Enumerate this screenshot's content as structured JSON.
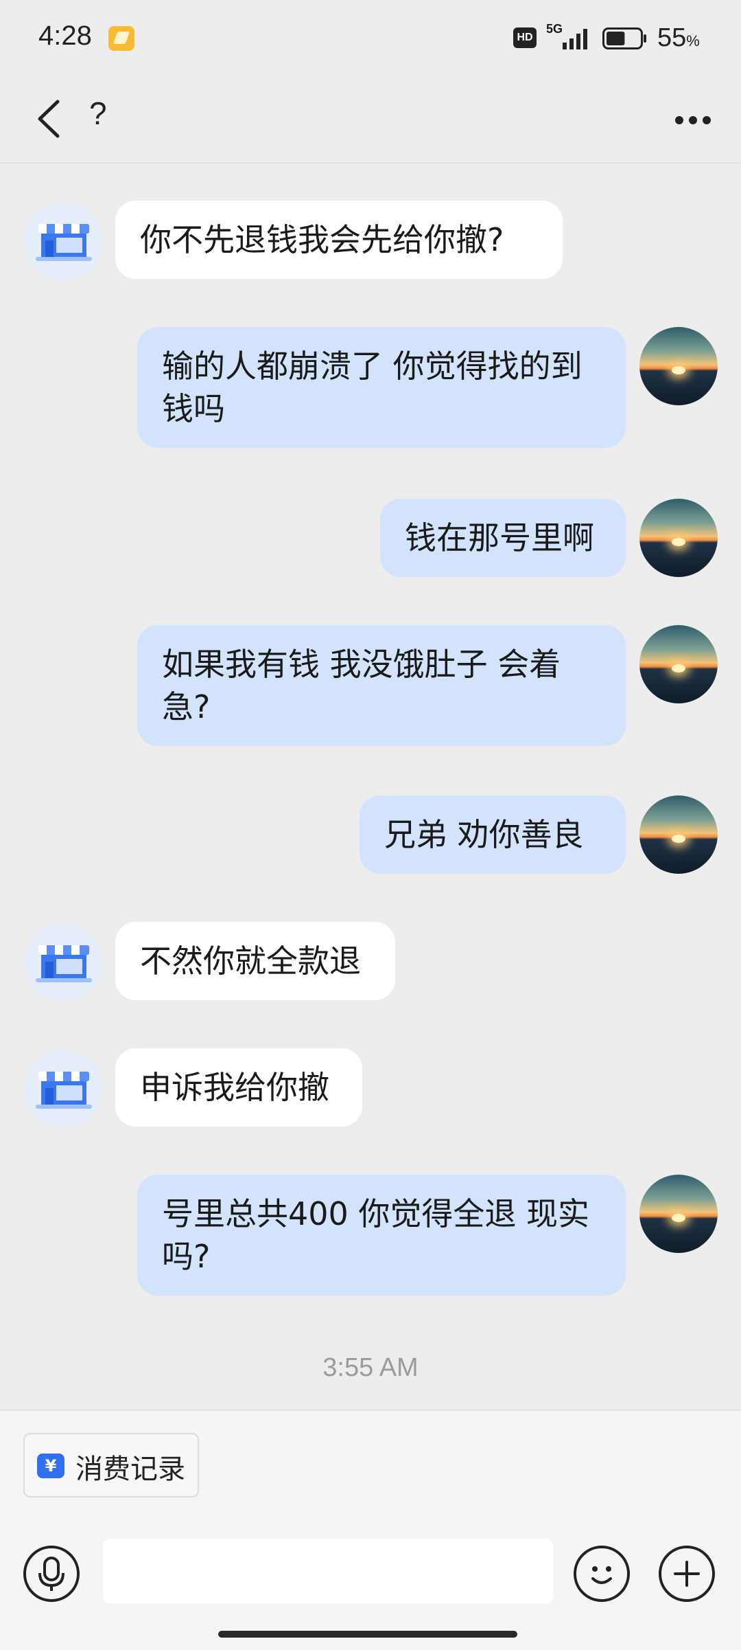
{
  "status_bar": {
    "time": "4:28",
    "hd": "HD",
    "network": "5G",
    "battery_value": "55",
    "battery_unit": "%",
    "battery_level": 0.55
  },
  "header": {
    "title": "?",
    "back_icon": "chevron-left-icon",
    "more_icon": "ellipsis-icon"
  },
  "messages": [
    {
      "side": "in",
      "text": "你不先退钱我会先给你撤?"
    },
    {
      "side": "out",
      "text": "输的人都崩溃了 你觉得找的到钱吗"
    },
    {
      "side": "out",
      "text": "钱在那号里啊"
    },
    {
      "side": "out",
      "text": " 如果我有钱  我没饿肚子  会着急?"
    },
    {
      "side": "out",
      "text": "兄弟  劝你善良"
    },
    {
      "side": "in",
      "text": "不然你就全款退"
    },
    {
      "side": "in",
      "text": "申诉我给你撤"
    },
    {
      "side": "out",
      "text": "号里总共400  你觉得全退  现实吗?"
    }
  ],
  "timestamp": "3:55 AM",
  "bottom": {
    "chip_label": "消费记录",
    "chip_icon_symbol": "¥",
    "input_placeholder": "",
    "icons": [
      "microphone-icon",
      "emoji-icon",
      "plus-icon"
    ]
  },
  "colors": {
    "background": "#ededed",
    "incoming_bubble": "#ffffff",
    "outgoing_bubble": "#d3e3fb",
    "accent": "#2f6ff0"
  }
}
